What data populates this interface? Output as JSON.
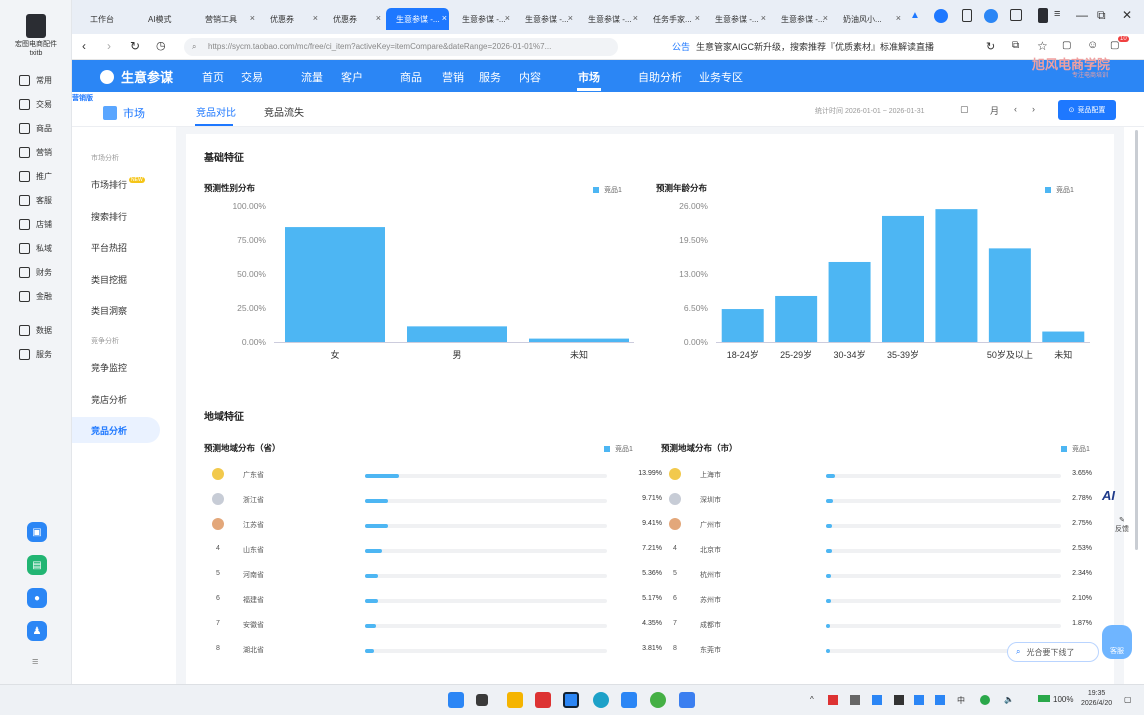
{
  "rail": {
    "user_line1": "宏图电商配件",
    "user_line2": "txitb",
    "items": [
      {
        "label": "常用",
        "icon": "home-icon"
      },
      {
        "label": "交易",
        "icon": "trade-icon"
      },
      {
        "label": "商品",
        "icon": "goods-icon"
      },
      {
        "label": "营销",
        "icon": "marketing-icon"
      },
      {
        "label": "推广",
        "icon": "promote-icon"
      },
      {
        "label": "客服",
        "icon": "service-icon"
      },
      {
        "label": "店铺",
        "icon": "shop-icon"
      },
      {
        "label": "私域",
        "icon": "private-icon"
      },
      {
        "label": "财务",
        "icon": "finance-icon"
      },
      {
        "label": "金融",
        "icon": "loan-icon"
      },
      {
        "label": "数据",
        "icon": "data-icon"
      },
      {
        "label": "服务",
        "icon": "service2-icon"
      }
    ],
    "apps": [
      {
        "color": "#2b86f5"
      },
      {
        "color": "#22b573"
      },
      {
        "color": "#2b86f5"
      },
      {
        "color": "#2b86f5"
      }
    ],
    "more": "≡"
  },
  "tabs": [
    "工作台",
    "AI模式",
    "营销工具",
    "优惠券",
    "优惠券",
    "生意参谋 -...",
    "生意参谋 -...",
    "生意参谋 -...",
    "生意参谋 -...",
    "任务手家...",
    "生意参谋 -...",
    "生意参谋 -...",
    "奶油风小..."
  ],
  "window": {
    "min": "—",
    "restore": "⧉",
    "close": "✕"
  },
  "address": {
    "url": "https://sycm.taobao.com/mc/free/ci_item?activeKey=itemCompare&dateRange=2026-01-01%7...",
    "notice_tag": "公告",
    "notice": "生意管家AIGC新升级，搜索推荐『优质素材』标准解读直播",
    "badge": "10"
  },
  "header": {
    "brand": "生意参谋",
    "nav": [
      "首页",
      "交易",
      "流量",
      "客户",
      "商品",
      "营销",
      "服务",
      "内容",
      "市场",
      "自助分析",
      "业务专区"
    ],
    "active": "市场",
    "watermark": "旭风电商学院",
    "watermark_sub": "专注电商培训"
  },
  "sub": {
    "badge": "营销版",
    "section": "市场",
    "tabs": [
      "竞品对比",
      "竞品流失"
    ],
    "date_label": "统计时间 2026-01-01 ~ 2026-01-31",
    "day": "日",
    "month": "月",
    "prev": "‹",
    "next": "›",
    "config_btn": "竞品配置"
  },
  "left_menu": {
    "sec1": "市场分析",
    "items1": [
      "市场排行",
      "搜索排行",
      "平台热招",
      "类目挖掘",
      "类目洞察"
    ],
    "new_tag": "NEW",
    "sec2": "竞争分析",
    "items2": [
      "竞争监控",
      "竞店分析",
      "竞品分析"
    ],
    "active": "竞品分析"
  },
  "basic": {
    "title": "基础特征",
    "gender_title": "预测性别分布",
    "age_title": "预测年龄分布",
    "legend": "竞品1",
    "gender_ylabels": [
      "100.00%",
      "75.00%",
      "50.00%",
      "25.00%",
      "0.00%"
    ],
    "age_ylabels": [
      "26.00%",
      "19.50%",
      "13.00%",
      "6.50%",
      "0.00%"
    ]
  },
  "region": {
    "title": "地域特征",
    "prov_title": "预测地域分布（省）",
    "city_title": "预测地域分布（市）",
    "legend": "竞品1",
    "provinces": [
      {
        "rank": "1",
        "name": "广东省",
        "pct": "13.99%",
        "v": 13.99
      },
      {
        "rank": "2",
        "name": "浙江省",
        "pct": "9.71%",
        "v": 9.71
      },
      {
        "rank": "3",
        "name": "江苏省",
        "pct": "9.41%",
        "v": 9.41
      },
      {
        "rank": "4",
        "name": "山东省",
        "pct": "7.21%",
        "v": 7.21
      },
      {
        "rank": "5",
        "name": "河南省",
        "pct": "5.36%",
        "v": 5.36
      },
      {
        "rank": "6",
        "name": "福建省",
        "pct": "5.17%",
        "v": 5.17
      },
      {
        "rank": "7",
        "name": "安徽省",
        "pct": "4.35%",
        "v": 4.35
      },
      {
        "rank": "8",
        "name": "湖北省",
        "pct": "3.81%",
        "v": 3.81
      }
    ],
    "cities": [
      {
        "rank": "1",
        "name": "上海市",
        "pct": "3.65%",
        "v": 3.65
      },
      {
        "rank": "2",
        "name": "深圳市",
        "pct": "2.78%",
        "v": 2.78
      },
      {
        "rank": "3",
        "name": "广州市",
        "pct": "2.75%",
        "v": 2.75
      },
      {
        "rank": "4",
        "name": "北京市",
        "pct": "2.53%",
        "v": 2.53
      },
      {
        "rank": "5",
        "name": "杭州市",
        "pct": "2.34%",
        "v": 2.34
      },
      {
        "rank": "6",
        "name": "苏州市",
        "pct": "2.10%",
        "v": 2.1
      },
      {
        "rank": "7",
        "name": "成都市",
        "pct": "1.87%",
        "v": 1.87
      },
      {
        "rank": "8",
        "name": "东莞市",
        "pct": "",
        "v": 1.7
      }
    ]
  },
  "float": {
    "ai": "AI",
    "feedback": "反馈",
    "help_input": "光合要下线了",
    "kefu": "客服"
  },
  "taskbar": {
    "battery": "100%",
    "time": "19:35",
    "date": "2026/4/20"
  },
  "colors": {
    "primary": "#1e78ff",
    "header": "#2b86f5",
    "bar": "#4db6f3"
  },
  "chart_data": [
    {
      "type": "bar",
      "title": "预测性别分布",
      "categories": [
        "女",
        "男",
        "未知"
      ],
      "series": [
        {
          "name": "竞品1",
          "values": [
            84.5,
            11.5,
            2.5
          ]
        }
      ],
      "ylim": [
        0,
        100
      ],
      "yticks": [
        "100.00%",
        "75.00%",
        "50.00%",
        "25.00%",
        "0.00%"
      ]
    },
    {
      "type": "bar",
      "title": "预测年龄分布",
      "categories": [
        "18-24岁",
        "25-29岁",
        "30-34岁",
        "35-39岁",
        "",
        "50岁及以上",
        "未知"
      ],
      "series": [
        {
          "name": "竞品1",
          "values": [
            6.3,
            8.8,
            15.3,
            24.1,
            25.4,
            17.9,
            2.0
          ]
        }
      ],
      "ylim": [
        0,
        26
      ],
      "yticks": [
        "26.00%",
        "19.50%",
        "13.00%",
        "6.50%",
        "0.00%"
      ]
    }
  ]
}
